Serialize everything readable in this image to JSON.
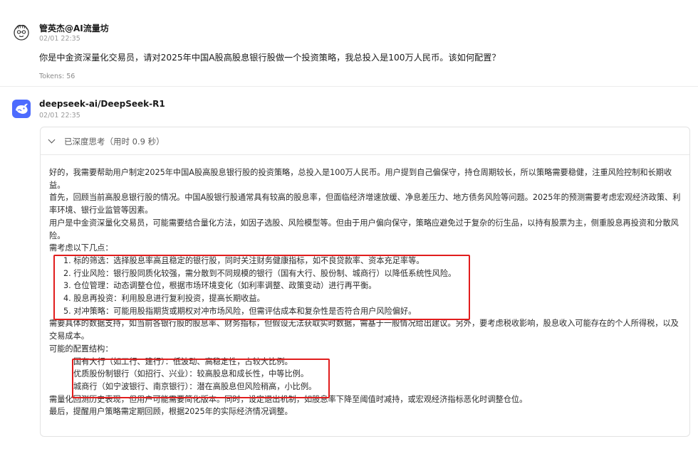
{
  "user": {
    "name": "管英杰@AI流量坊",
    "time": "02/01 22:35",
    "message": "你是中金资深量化交易员，请对2025年中国A股高股息银行股做一个投资策略，我总投入是100万人民币。该如何配置？",
    "tokens": "Tokens: 56"
  },
  "bot": {
    "name": "deepseek-ai/DeepSeek-R1",
    "time": "02/01 22:35",
    "think_label": "已深度思考（用时 0.9 秒）",
    "paragraphs": {
      "p1": "好的，我需要帮助用户制定2025年中国A股高股息银行股的投资策略，总投入是100万人民币。用户提到自己偏保守，持仓周期较长，所以策略需要稳健，注重风险控制和长期收益。",
      "p2": "首先，回顾当前高股息银行股的情况。中国A股银行股通常具有较高的股息率，但面临经济增速放缓、净息差压力、地方债务风险等问题。2025年的预测需要考虑宏观经济政策、利率环境、银行业监管等因素。",
      "p3": "用户是中金资深量化交易员，可能需要结合量化方法，如因子选股、风险模型等。但由于用户偏向保守，策略应避免过于复杂的衍生品，以持有股票为主，侧重股息再投资和分散风险。",
      "p4": "需考虑以下几点：",
      "list": [
        "1. 标的筛选：选择股息率高且稳定的银行股，同时关注财务健康指标，如不良贷款率、资本充足率等。",
        "2. 行业风险：银行股同质化较强，需分散到不同规模的银行（国有大行、股份制、城商行）以降低系统性风险。",
        "3. 仓位管理：动态调整仓位，根据市场环境变化（如利率调整、政策变动）进行再平衡。",
        "4. 股息再投资：利用股息进行复利投资，提高长期收益。",
        "5. 对冲策略：可能用股指期货或期权对冲市场风险，但需评估成本和复杂性是否符合用户风险偏好。"
      ],
      "p5": "需要具体的数据支持，如当前各银行股的股息率、财务指标，但假设无法获取实时数据，需基于一般情况给出建议。另外，要考虑税收影响，股息收入可能存在的个人所得税，以及交易成本。",
      "p6": "可能的配置结构：",
      "alloc": [
        "国有大行（如工行、建行）：低波动、高稳定性，占较大比例。",
        "优质股份制银行（如招行、兴业）：较高股息和成长性，中等比例。",
        "城商行（如宁波银行、南京银行）：潜在高股息但风险稍高，小比例。"
      ],
      "p7": "需量化回测历史表现，但用户可能需要简化版本。同时，设定退出机制，如股息率下降至阈值时减持，或宏观经济指标恶化时调整仓位。",
      "p8": "最后，提醒用户策略需定期回顾，根据2025年的实际经济情况调整。"
    }
  },
  "colors": {
    "highlight_box": "#e11d1d",
    "bot_avatar": "#4d6bfe"
  },
  "icons": {
    "user_avatar": "cartoon-face-icon",
    "bot_avatar": "deepseek-whale-icon",
    "collapse": "chevron-down-icon"
  }
}
